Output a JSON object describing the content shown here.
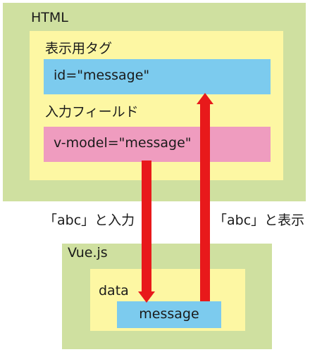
{
  "diagram": {
    "html_title": "HTML",
    "view_tag_title": "表示用タグ",
    "view_tag_attribute": "id=\"message\"",
    "input_field_title": "入力フィールド",
    "input_field_attribute": "v-model=\"message\"",
    "vue_title": "Vue.js",
    "data_title": "data",
    "data_property": "message",
    "input_action_label": "「abc」と入力",
    "display_action_label": "「abc」と表示"
  },
  "colors": {
    "outer_green": "#cfe0a0",
    "inner_yellow": "#fdf7a3",
    "field_blue": "#7ccbee",
    "field_pink": "#ef9cbf",
    "arrow_red": "#e8191b"
  }
}
